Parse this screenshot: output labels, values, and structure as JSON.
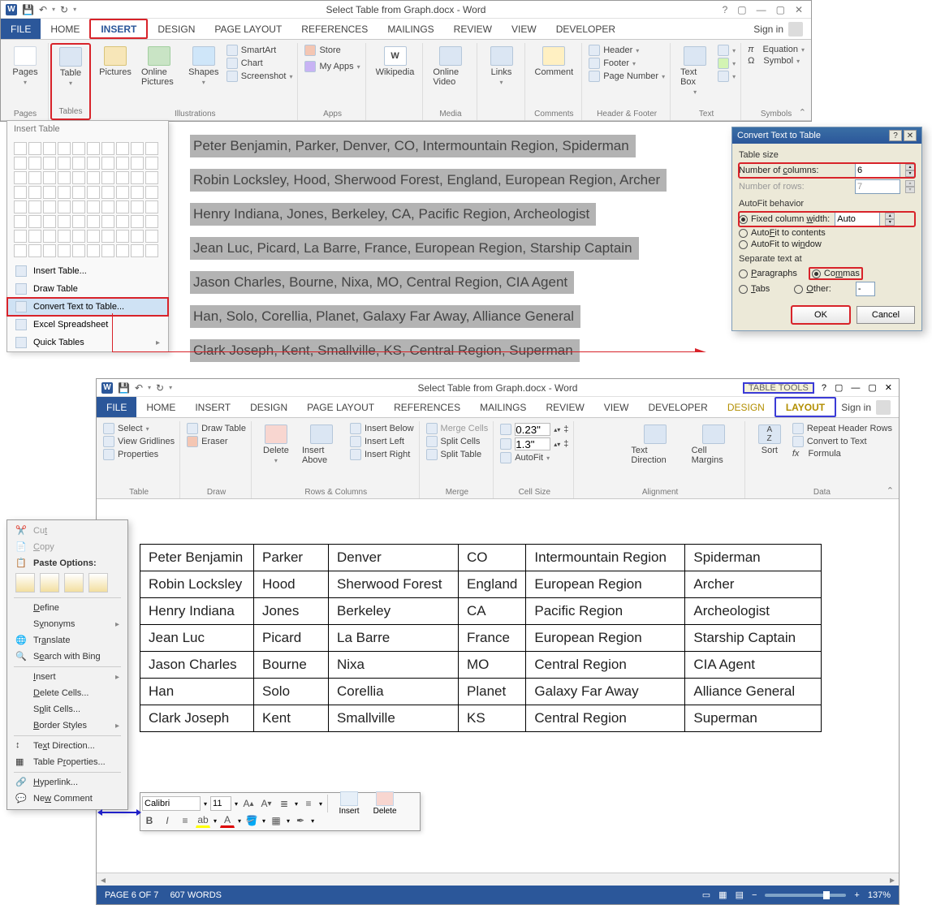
{
  "window1": {
    "title": "Select Table from Graph.docx - Word",
    "qat": [
      "WORD",
      "save",
      "undo",
      "redo"
    ],
    "winbtns": {
      "help": "?",
      "full": "▢",
      "min": "—",
      "max": "▢",
      "close": "✕"
    },
    "tabs": [
      "FILE",
      "HOME",
      "INSERT",
      "DESIGN",
      "PAGE LAYOUT",
      "REFERENCES",
      "MAILINGS",
      "REVIEW",
      "VIEW",
      "DEVELOPER"
    ],
    "signin": "Sign in",
    "ribbon_groups": {
      "pages": {
        "label": "Pages",
        "btn": "Pages"
      },
      "tables": {
        "label": "Tables",
        "btn": "Table"
      },
      "illus": {
        "label": "Illustrations",
        "pictures": "Pictures",
        "online": "Online Pictures",
        "shapes": "Shapes",
        "smartart": "SmartArt",
        "chart": "Chart",
        "screenshot": "Screenshot"
      },
      "apps": {
        "label": "Apps",
        "store": "Store",
        "myapps": "My Apps"
      },
      "wiki": "Wikipedia",
      "media": {
        "label": "Media",
        "online_video": "Online Video"
      },
      "links": {
        "label": "Links",
        "btn": "Links"
      },
      "comments": {
        "label": "Comments",
        "btn": "Comment"
      },
      "hf": {
        "label": "Header & Footer",
        "header": "Header",
        "footer": "Footer",
        "page_no": "Page Number"
      },
      "text": {
        "label": "Text",
        "box": "Text Box"
      },
      "symbols": {
        "label": "Symbols",
        "eq": "Equation",
        "sym": "Symbol"
      }
    }
  },
  "insert_table_menu": {
    "header": "Insert Table",
    "items": [
      "Insert Table...",
      "Draw Table",
      "Convert Text to Table...",
      "Excel Spreadsheet",
      "Quick Tables"
    ]
  },
  "doc_lines": [
    "Peter Benjamin, Parker, Denver, CO, Intermountain Region, Spiderman",
    "Robin Locksley, Hood, Sherwood Forest, England, European Region, Archer",
    "Henry Indiana, Jones, Berkeley, CA, Pacific Region, Archeologist",
    "Jean Luc, Picard, La Barre, France, European Region, Starship Captain",
    "Jason Charles, Bourne, Nixa, MO, Central Region, CIA Agent",
    "Han, Solo, Corellia, Planet, Galaxy Far Away, Alliance General",
    "Clark Joseph, Kent, Smallville, KS, Central Region, Superman"
  ],
  "dialog": {
    "title": "Convert Text to Table",
    "table_size": "Table size",
    "ncols_label": "Number of columns:",
    "ncols_val": "6",
    "nrows_label": "Number of rows:",
    "nrows_val": "7",
    "autofit": "AutoFit behavior",
    "fixed": "Fixed column width:",
    "fixed_val": "Auto",
    "autofit_contents": "AutoFit to contents",
    "autofit_window": "AutoFit to window",
    "sep": "Separate text at",
    "paragraphs": "Paragraphs",
    "commas": "Commas",
    "tabs_lbl": "Tabs",
    "other": "Other:",
    "other_val": "-",
    "ok": "OK",
    "cancel": "Cancel"
  },
  "window2": {
    "title": "Select Table from Graph.docx - Word",
    "table_tools": "TABLE TOOLS",
    "tabs": [
      "FILE",
      "HOME",
      "INSERT",
      "DESIGN",
      "PAGE LAYOUT",
      "REFERENCES",
      "MAILINGS",
      "REVIEW",
      "VIEW",
      "DEVELOPER",
      "DESIGN",
      "LAYOUT"
    ],
    "signin": "Sign in",
    "ribbon": {
      "table": {
        "label": "Table",
        "select": "Select",
        "gridlines": "View Gridlines",
        "props": "Properties"
      },
      "draw": {
        "label": "Draw",
        "drawtable": "Draw Table",
        "eraser": "Eraser"
      },
      "rowscols": {
        "label": "Rows & Columns",
        "delete": "Delete",
        "insabove": "Insert Above",
        "insbelow": "Insert Below",
        "insleft": "Insert Left",
        "insright": "Insert Right"
      },
      "merge": {
        "label": "Merge",
        "mc": "Merge Cells",
        "sc": "Split Cells",
        "st": "Split Table"
      },
      "cellsize": {
        "label": "Cell Size",
        "h": "0.23\"",
        "w": "1.3\"",
        "autofit": "AutoFit"
      },
      "align": {
        "label": "Alignment",
        "td": "Text Direction",
        "cm": "Cell Margins"
      },
      "data": {
        "label": "Data",
        "sort": "Sort",
        "rh": "Repeat Header Rows",
        "ctt": "Convert to Text",
        "fx": "Formula"
      }
    }
  },
  "result_table": [
    [
      "Peter Benjamin",
      "Parker",
      "Denver",
      "CO",
      "Intermountain Region",
      "Spiderman"
    ],
    [
      "Robin Locksley",
      "Hood",
      "Sherwood Forest",
      "England",
      "European Region",
      "Archer"
    ],
    [
      "Henry Indiana",
      "Jones",
      "Berkeley",
      "CA",
      "Pacific Region",
      "Archeologist"
    ],
    [
      "Jean Luc",
      "Picard",
      "La Barre",
      "France",
      "European Region",
      "Starship Captain"
    ],
    [
      "Jason Charles",
      "Bourne",
      "Nixa",
      "MO",
      "Central Region",
      "CIA Agent"
    ],
    [
      "Han",
      "Solo",
      "Corellia",
      "Planet",
      "Galaxy Far Away",
      "Alliance General"
    ],
    [
      "Clark Joseph",
      "Kent",
      "Smallville",
      "KS",
      "Central Region",
      "Superman"
    ]
  ],
  "context_menu": {
    "cut": "Cut",
    "copy": "Copy",
    "po": "Paste Options:",
    "define": "Define",
    "syn": "Synonyms",
    "translate": "Translate",
    "bing": "Search with Bing",
    "insert": "Insert",
    "delcells": "Delete Cells...",
    "splitcells": "Split Cells...",
    "border": "Border Styles",
    "txtdir": "Text Direction...",
    "tableprops": "Table Properties...",
    "hyperlink": "Hyperlink...",
    "newcomment": "New Comment"
  },
  "mini_toolbar": {
    "font": "Calibri",
    "size": "11",
    "insert": "Insert",
    "delete": "Delete"
  },
  "status": {
    "page": "PAGE 6 OF 7",
    "words": "607 WORDS",
    "zoom": "137%"
  }
}
